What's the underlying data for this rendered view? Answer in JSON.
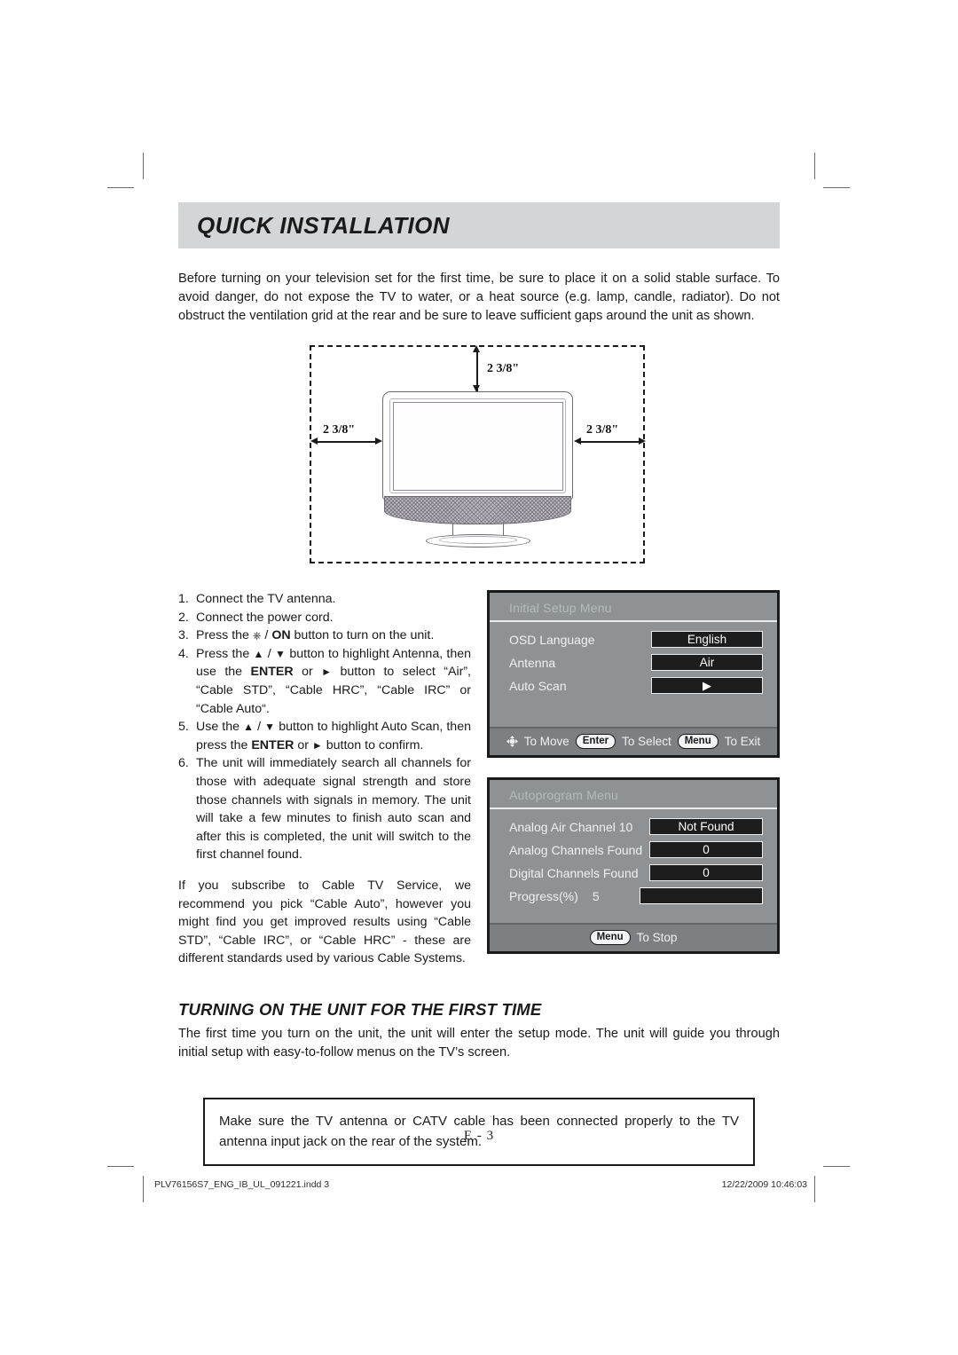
{
  "header": {
    "title": "QUICK INSTALLATION"
  },
  "intro": "Before turning on your television set for the first time, be sure to place it on a solid stable surface. To avoid danger, do not expose the TV to water, or a heat source (e.g. lamp, candle, radiator). Do not obstruct the ventilation grid at the rear and be sure to leave sufficient gaps around the unit as shown.",
  "diagram": {
    "top_label": "2  3/8\"",
    "left_label": "2  3/8\"",
    "right_label": "2  3/8\""
  },
  "steps": [
    {
      "num": "1.",
      "text": "Connect the TV antenna."
    },
    {
      "num": "2.",
      "text": "Connect the power cord."
    },
    {
      "num": "3.",
      "text_html": "Press the <span class=\"glyph\">&#9096;</span> / <b>ON</b> button to turn on the unit."
    },
    {
      "num": "4.",
      "text_html": "Press the <span class=\"glyph\">&#9650;</span> / <span class=\"glyph\">&#9660;</span> button to highlight Antenna, then use the <b>ENTER</b> or <span class=\"glyph\">&#9658;</span> button to select &ldquo;Air&rdquo;, &ldquo;Cable STD&rdquo;, &ldquo;Cable HRC&rdquo;, &ldquo;Cable IRC&rdquo; or &ldquo;Cable Auto&ldquo;."
    },
    {
      "num": "5.",
      "text_html": "Use the <span class=\"glyph\">&#9650;</span> / <span class=\"glyph\">&#9660;</span> button to highlight Auto Scan, then press the <b>ENTER</b> or <span class=\"glyph\">&#9658;</span> button to confirm."
    },
    {
      "num": "6.",
      "text_html": "The unit will immediately search all channels for those with adequate signal strength and store those channels with signals in memory. The unit will take a few minutes to finish auto scan and after this is completed, the unit will switch to the first channel found."
    }
  ],
  "steps_extra_paragraph": "If you subscribe to Cable TV Service, we recommend you pick “Cable Auto”, however you might find you get improved results using “Cable STD”, “Cable IRC”, or “Cable HRC” - these are different standards used by various Cable Systems.",
  "osd_initial": {
    "title": "Initial Setup Menu",
    "rows": [
      {
        "label": "OSD Language",
        "value": "English"
      },
      {
        "label": "Antenna",
        "value": "Air"
      },
      {
        "label": "Auto Scan",
        "value": "▶"
      }
    ],
    "footer": {
      "move_label": "To Move",
      "enter_key": "Enter",
      "select_label": "To Select",
      "menu_key": "Menu",
      "exit_label": "To Exit"
    }
  },
  "osd_autoprogram": {
    "title": "Autoprogram Menu",
    "rows": [
      {
        "label": "Analog Air Channel 10",
        "value": "Not Found"
      },
      {
        "label": "Analog Channels Found",
        "value": "0"
      },
      {
        "label": "Digital Channels Found",
        "value": "0"
      }
    ],
    "progress": {
      "label": "Progress(%)",
      "value": "5"
    },
    "footer": {
      "menu_key": "Menu",
      "stop_label": "To Stop"
    }
  },
  "section": {
    "heading": "TURNING ON THE UNIT FOR THE FIRST TIME",
    "body": "The first time you turn on the unit, the unit will enter the setup mode. The unit will guide you through initial setup with easy-to-follow menus  on the TV’s screen."
  },
  "note": "Make sure the TV antenna or CATV cable has been connected properly to the TV antenna input jack on the rear of the system.",
  "footer": {
    "page_number": "E - 3",
    "file_name": "PLV76156S7_ENG_IB_UL_091221.indd   3",
    "timestamp": "12/22/2009   10:46:03"
  },
  "colors": {
    "title_bar": "#d4d5d6",
    "osd_background": "#8e9294",
    "osd_footer": "#7c8082",
    "osd_value_background": "#1d1d1d",
    "text": "#1a1a1a"
  }
}
